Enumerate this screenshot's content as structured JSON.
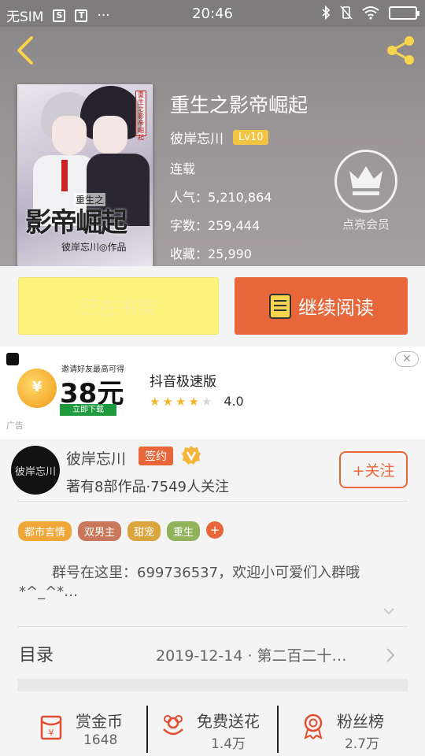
{
  "status_bar": {
    "carrier": "无SIM",
    "time": "20:46",
    "icon_s": "S",
    "icon_t": "T",
    "more": "···"
  },
  "book": {
    "title": "重生之影帝崛起",
    "author": "彼岸忘川",
    "level": "Lv10",
    "status": "连载",
    "popularity": "人气：5,210,864",
    "word_count": "字数：259,444",
    "favorites": "收藏：25,990"
  },
  "cover": {
    "title_text": "影帝崛起",
    "subtitle_text": "重生之",
    "author_text": "彼岸忘川◎作品",
    "vertical_text": "重生之影帝崛起"
  },
  "vip": {
    "label": "点亮会员"
  },
  "actions": {
    "shelf_label": "已在书架",
    "read_label": "继续阅读"
  },
  "ad": {
    "top_text": "邀请好友最高可得",
    "amount": "38元",
    "download": "立即下载",
    "ad_label": "广告",
    "app_name": "抖音极速版",
    "rating": "4.0",
    "close": "✕"
  },
  "author_card": {
    "avatar_text": "彼岸忘川",
    "name": "彼岸忘川",
    "sign_badge": "签约",
    "stats": "著有8部作品·7549人关注",
    "follow": "+关注"
  },
  "tags": [
    {
      "label": "都市言情",
      "color": "#f0a73a"
    },
    {
      "label": "双男主",
      "color": "#c9785c"
    },
    {
      "label": "甜宠",
      "color": "#d9a53c"
    },
    {
      "label": "重生",
      "color": "#8fb25a"
    }
  ],
  "tag_more": "+",
  "intro": "群号在这里：699736537，欢迎小可爱们入群哦*^_^*…",
  "toc": {
    "label": "目录",
    "latest": "2019-12-14 · 第二百二十…"
  },
  "bottom": [
    {
      "label": "赏金币",
      "value": "1648",
      "icon": "red-envelope-icon"
    },
    {
      "label": "免费送花",
      "value": "1.4万",
      "icon": "flower-icon"
    },
    {
      "label": "粉丝榜",
      "value": "2.7万",
      "icon": "medal-icon"
    }
  ],
  "colors": {
    "accent": "#e8673a",
    "shelf": "#fdf27b",
    "hero_bg": "#9b9697",
    "vip_ring": "#f2f2f2"
  }
}
